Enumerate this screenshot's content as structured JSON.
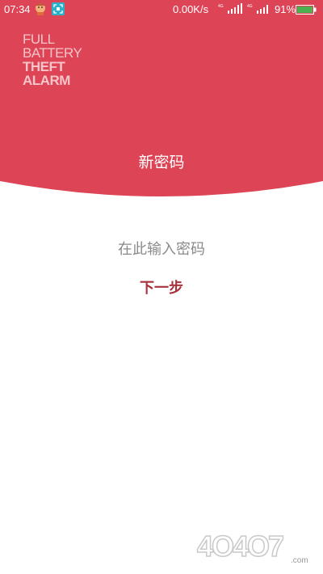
{
  "status_bar": {
    "time": "07:34",
    "network_speed": "0.00K/s",
    "battery_percent": "91%",
    "icons": [
      "avatar-notification-icon",
      "scan-notification-icon",
      "cell-signal-4g-icon",
      "cell-signal-4g-icon",
      "wifi-signal-icon",
      "battery-icon"
    ]
  },
  "header": {
    "logo_lines": [
      "FULL",
      "BATTERY",
      "THEFT",
      "ALARM"
    ],
    "title": "新密码",
    "bg_color": "#dd4455"
  },
  "form": {
    "password_placeholder": "在此输入密码",
    "next_label": "下一步"
  },
  "watermark": {
    "text": "4O4O7.com"
  }
}
